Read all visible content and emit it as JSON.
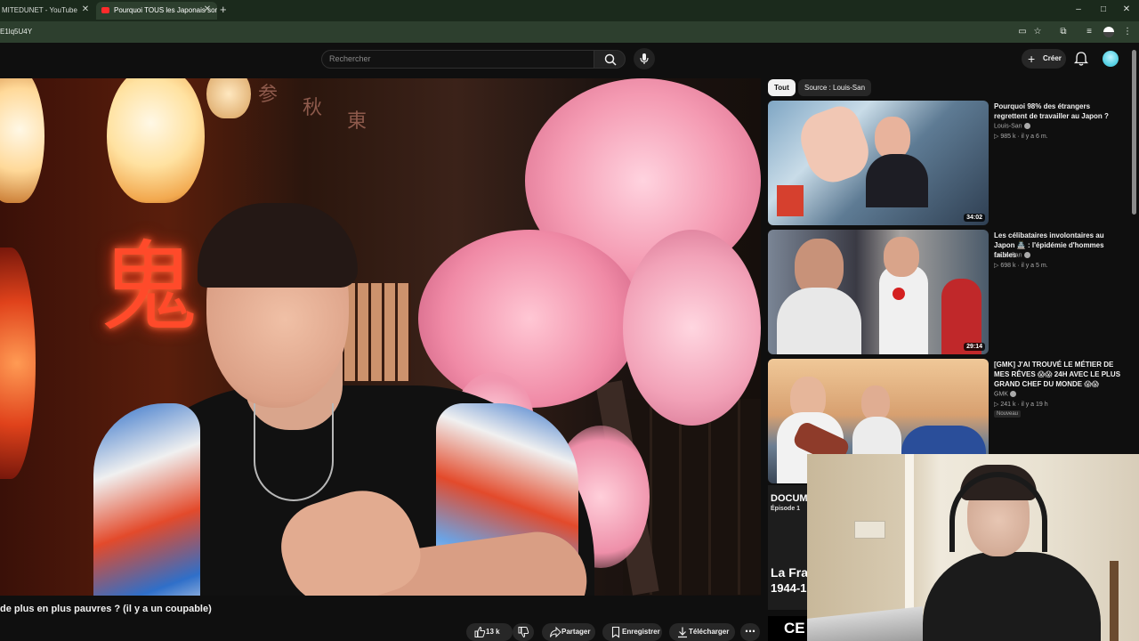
{
  "browser": {
    "tabs": [
      {
        "label": "MITEDUNET - YouTube"
      },
      {
        "label": "Pourquoi TOUS les Japonais sont",
        "active": true
      }
    ],
    "new_tab": "+",
    "address": "E1lq5U4Y",
    "window_controls": [
      "–",
      "□",
      "✕"
    ]
  },
  "youtube": {
    "search_placeholder": "Rechercher",
    "create_label": "Créer",
    "video": {
      "title": "de plus en plus pauvres ? (il y a un coupable)",
      "like_count": "13 k",
      "actions": {
        "share": "Partager",
        "save": "Enregistrer",
        "download": "Télécharger"
      }
    },
    "sidebar": {
      "chips": [
        "Tout",
        "Source : Louis-San"
      ],
      "videos": [
        {
          "title": "Pourquoi 98% des étrangers regrettent de travailler au Japon ?",
          "channel": "Louis-San",
          "meta": "▷ 985 k · il y a 6 m.",
          "duration": "34:02"
        },
        {
          "title": "Les célibataires involontaires au Japon 🏯 : l'épidémie d'hommes faibles",
          "channel": "Louis-San",
          "meta": "▷ 698 k · il y a 5 m.",
          "duration": "29:14"
        },
        {
          "title": "[GMK] J'AI TROUVÉ LE MÉTIER DE MES RÊVES 😱😱 24H AVEC LE PLUS GRAND CHEF DU MONDE 😱😱",
          "channel": "GMK",
          "meta": "▷ 241 k · il y a 19 h",
          "badge": "Nouveau"
        }
      ],
      "partial_thumb": {
        "line1": "DOCUM",
        "line2": "Épisode 1",
        "line3": "La Fra",
        "line4": "1944-1",
        "line5": "CE"
      }
    }
  },
  "colors": {
    "accent_red": "#ff0000",
    "chrome_green": "#2d3f2e",
    "yt_bg": "#0f0f0f"
  }
}
